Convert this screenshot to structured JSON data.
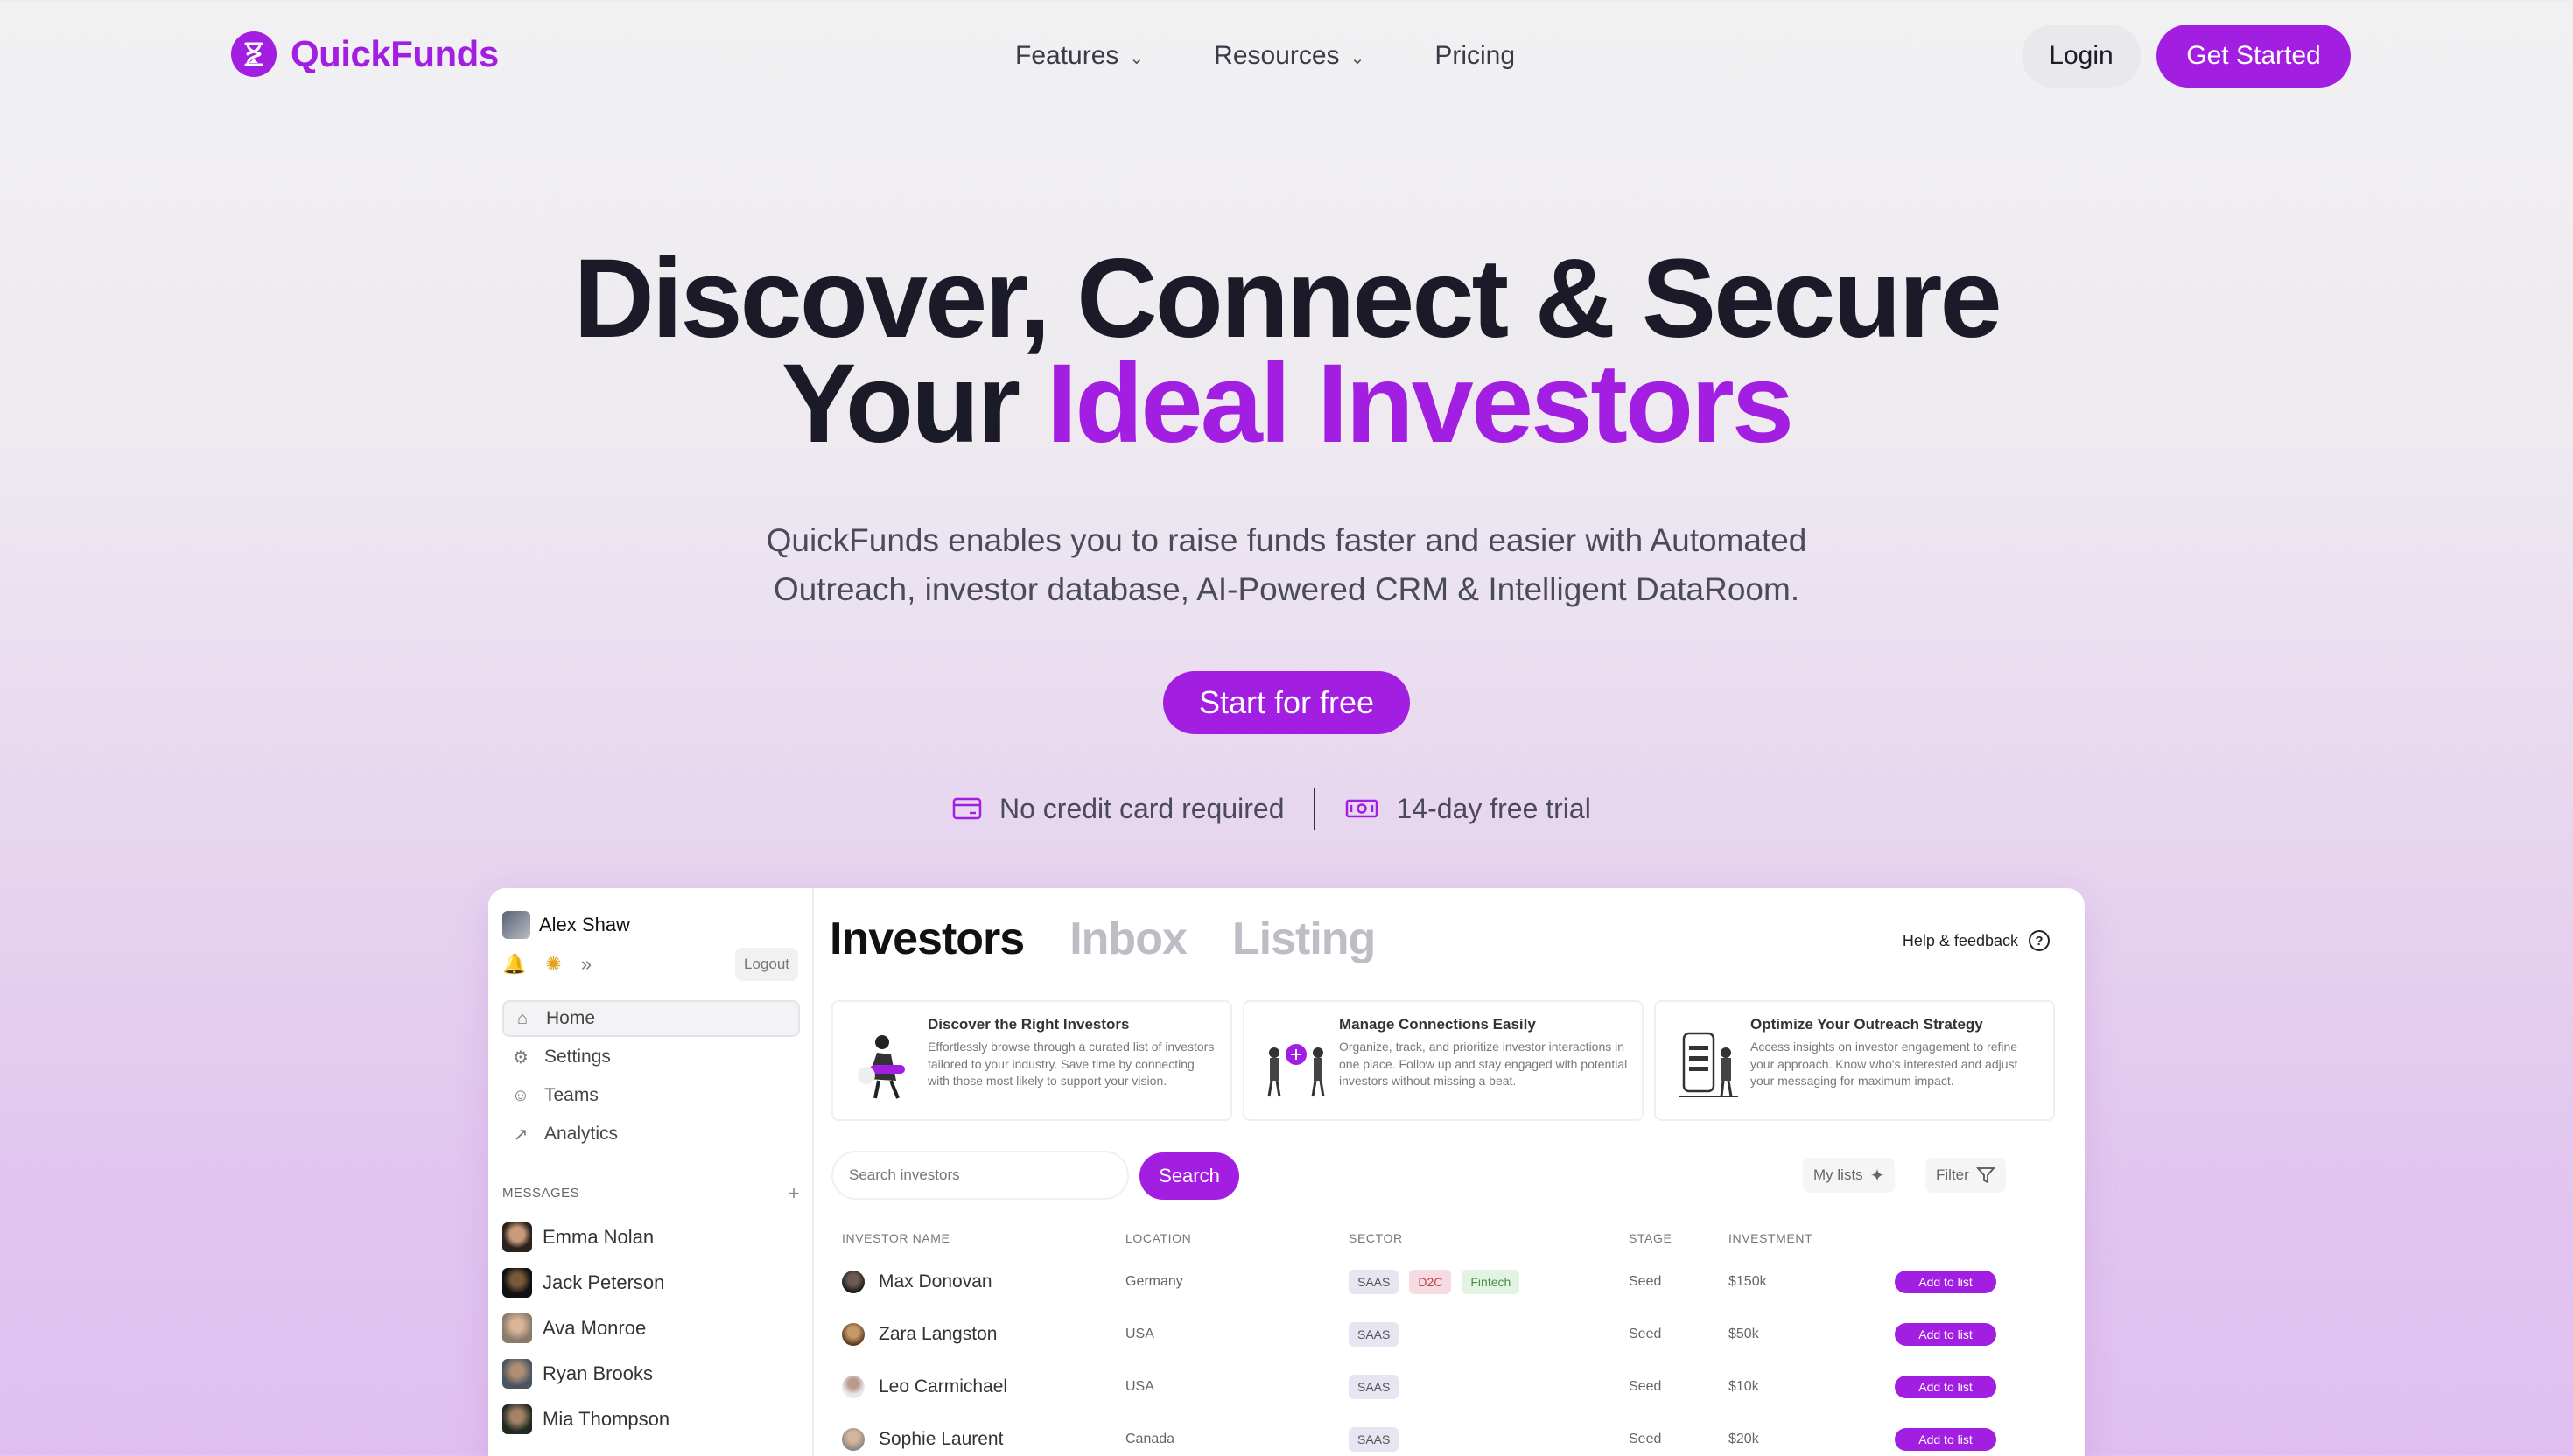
{
  "brand": {
    "name": "QuickFunds",
    "color": "#a21ee0",
    "logo_icon": "hourglass-icon"
  },
  "nav": {
    "items": [
      {
        "label": "Features",
        "has_dropdown": true
      },
      {
        "label": "Resources",
        "has_dropdown": true
      },
      {
        "label": "Pricing",
        "has_dropdown": false
      }
    ],
    "login_label": "Login",
    "cta_label": "Get Started"
  },
  "hero": {
    "title_line1": "Discover, Connect & Secure",
    "title_line2_plain": "Your ",
    "title_line2_accent": "Ideal Investors",
    "subtitle": "QuickFunds enables you to raise funds faster and easier with Automated Outreach, investor database, AI-Powered CRM & Intelligent DataRoom.",
    "button_label": "Start for free",
    "perks": [
      {
        "icon": "credit-card-icon",
        "label": "No credit card required"
      },
      {
        "icon": "money-icon",
        "label": "14-day free trial"
      }
    ]
  },
  "app": {
    "user": {
      "name": "Alex Shaw"
    },
    "logout_label": "Logout",
    "sidebar": [
      {
        "icon": "home-icon",
        "label": "Home",
        "active": true
      },
      {
        "icon": "gear-icon",
        "label": "Settings"
      },
      {
        "icon": "users-icon",
        "label": "Teams"
      },
      {
        "icon": "chart-icon",
        "label": "Analytics"
      }
    ],
    "messages_header": "MESSAGES",
    "messages": [
      {
        "name": "Emma Nolan"
      },
      {
        "name": "Jack Peterson"
      },
      {
        "name": "Ava Monroe"
      },
      {
        "name": "Ryan Brooks"
      },
      {
        "name": "Mia Thompson"
      }
    ],
    "tabs": [
      {
        "label": "Investors",
        "active": true
      },
      {
        "label": "Inbox"
      },
      {
        "label": "Listing"
      }
    ],
    "help_label": "Help & feedback",
    "cards": [
      {
        "title": "Discover the Right Investors",
        "desc": "Effortlessly browse through a curated list of investors tailored to your industry. Save time by connecting with those most likely to support your vision."
      },
      {
        "title": "Manage Connections Easily",
        "desc": "Organize, track, and prioritize investor interactions in one place. Follow up and stay engaged with potential investors without missing a beat."
      },
      {
        "title": "Optimize Your Outreach Strategy",
        "desc": "Access insights on investor engagement to refine your approach. Know who's interested and adjust your messaging for maximum impact."
      }
    ],
    "search": {
      "placeholder": "Search investors",
      "button_label": "Search"
    },
    "my_lists_label": "My lists",
    "filter_label": "Filter",
    "table": {
      "headers": [
        "INVESTOR NAME",
        "LOCATION",
        "SECTOR",
        "STAGE",
        "INVESTMENT",
        ""
      ],
      "rows": [
        {
          "name": "Max Donovan",
          "location": "Germany",
          "sectors": [
            "SAAS",
            "D2C",
            "Fintech"
          ],
          "stage": "Seed",
          "investment": "$150k",
          "action": "Add to list"
        },
        {
          "name": "Zara Langston",
          "location": "USA",
          "sectors": [
            "SAAS"
          ],
          "stage": "Seed",
          "investment": "$50k",
          "action": "Add to list"
        },
        {
          "name": "Leo Carmichael",
          "location": "USA",
          "sectors": [
            "SAAS"
          ],
          "stage": "Seed",
          "investment": "$10k",
          "action": "Add to list"
        },
        {
          "name": "Sophie Laurent",
          "location": "Canada",
          "sectors": [
            "SAAS"
          ],
          "stage": "Seed",
          "investment": "$20k",
          "action": "Add to list"
        }
      ]
    }
  }
}
